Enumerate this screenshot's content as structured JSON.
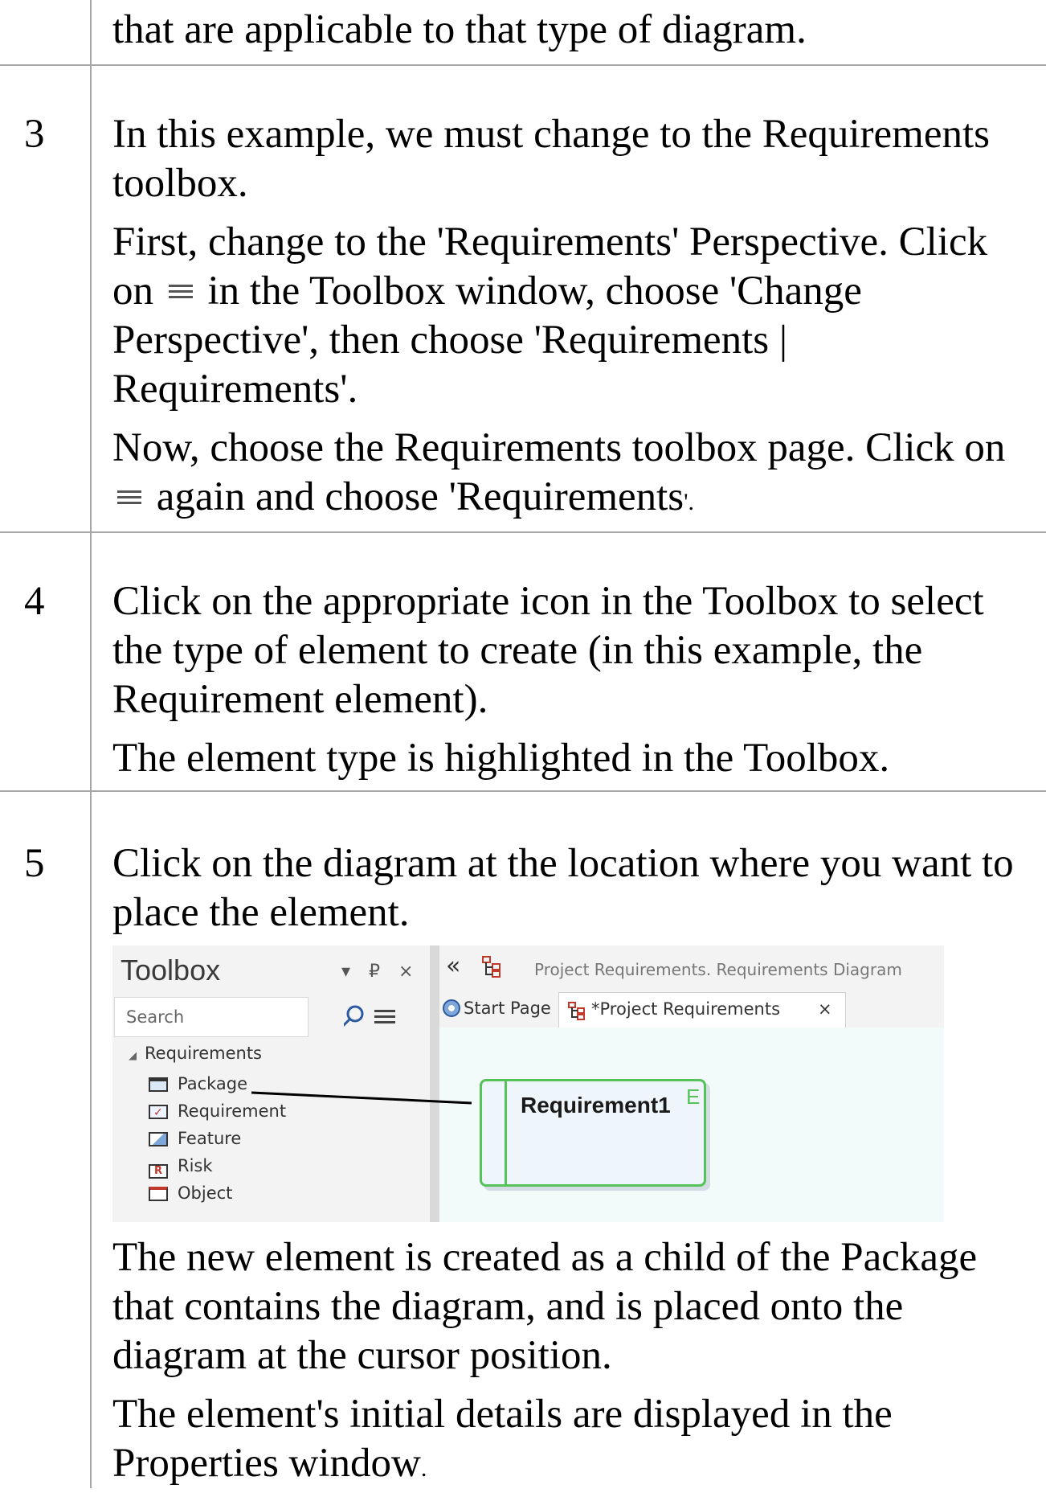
{
  "continuation": "that are applicable to that type of diagram.",
  "steps": [
    {
      "num": "3",
      "p1": "In this example, we must change to the Requirements toolbox.",
      "p2_before": "First, change to the 'Requirements' Perspective. Click on",
      "p2_after": "in the Toolbox window, choose 'Change Perspective', then choose 'Requirements | Requirements'.",
      "p3_before": "Now, choose the Requirements toolbox page.  Click on",
      "p3_after": "again and choose 'Requirements",
      "p3_end": "'."
    },
    {
      "num": "4",
      "p1": "Click on the appropriate icon in the Toolbox to select the type of element to create (in this example, the Requirement element).",
      "p2": "The element type is highlighted in the Toolbox."
    },
    {
      "num": "5",
      "p1": "Click on the diagram at the location where you want to place the element.",
      "p2": "The new element is created as a child of the Package that contains the diagram, and is placed onto the diagram at the cursor position.",
      "p3": "The element's initial details are displayed in the Properties window",
      "p3_end": "."
    }
  ],
  "screenshot": {
    "toolbox": {
      "title": "Toolbox",
      "controls": "▾ ₽ ×",
      "search_placeholder": "Search",
      "group": "Requirements",
      "items": [
        "Package",
        "Requirement",
        "Feature",
        "Risk",
        "Object"
      ]
    },
    "diagram": {
      "collapse": "«",
      "path": "Project Requirements.  Requirements Diagram",
      "tabs": [
        "Start Page",
        "*Project Requirements"
      ],
      "tab_close": "×",
      "element_name": "Requirement1",
      "element_tag": "E"
    }
  }
}
